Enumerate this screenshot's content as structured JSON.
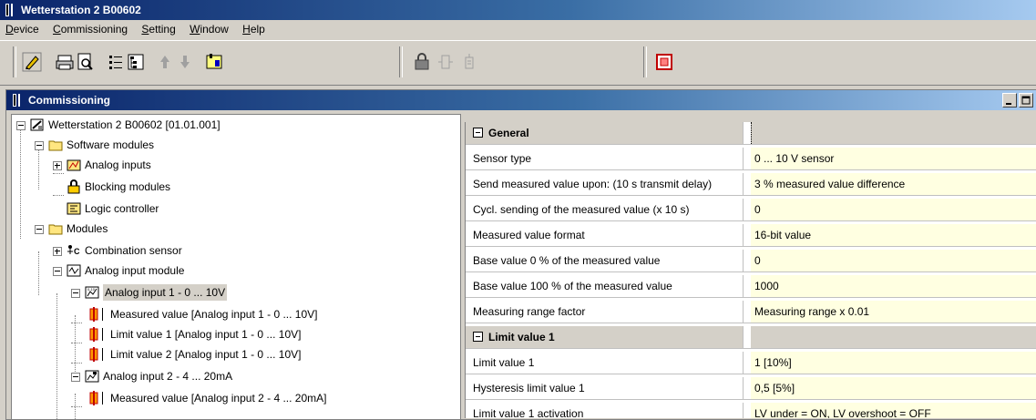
{
  "app": {
    "title": "Wetterstation 2 B00602"
  },
  "menu": [
    {
      "label": "Device",
      "u": "D",
      "rest": "evice"
    },
    {
      "label": "Commissioning",
      "u": "C",
      "rest": "ommissioning"
    },
    {
      "label": "Setting",
      "u": "S",
      "rest": "etting"
    },
    {
      "label": "Window",
      "u": "W",
      "rest": "indow"
    },
    {
      "label": "Help",
      "u": "H",
      "rest": "elp"
    }
  ],
  "child_window": {
    "title": "Commissioning"
  },
  "tree": {
    "root": "Wetterstation 2 B00602 [01.01.001]",
    "software_modules": "Software modules",
    "analog_inputs": "Analog inputs",
    "blocking_modules": "Blocking modules",
    "logic_controller": "Logic controller",
    "modules": "Modules",
    "combination_sensor": "Combination sensor",
    "analog_input_module": "Analog input module",
    "analog_input_1": "Analog input 1 - 0 ... 10V",
    "ai1_measured": "Measured value [Analog input 1 - 0 ... 10V]",
    "ai1_limit1": "Limit value 1 [Analog input 1 - 0 ... 10V]",
    "ai1_limit2": "Limit value 2 [Analog input 1 - 0 ... 10V]",
    "analog_input_2": "Analog input 2 - 4 ... 20mA",
    "ai2_measured": "Measured value [Analog input 2 - 4 ... 20mA]"
  },
  "properties": {
    "general_header": "General",
    "rows": [
      {
        "name": "Sensor type",
        "value": "0 ... 10 V sensor"
      },
      {
        "name": "Send measured value upon: (10 s transmit delay)",
        "value": "3 % measured value difference"
      },
      {
        "name": "Cycl. sending of the measured value (x 10 s)",
        "value": "0"
      },
      {
        "name": "Measured value format",
        "value": "16-bit value"
      },
      {
        "name": "Base value 0 % of the measured value",
        "value": "0"
      },
      {
        "name": "Base value 100 % of the measured value",
        "value": "1000"
      },
      {
        "name": "Measuring range factor",
        "value": "Measuring range x 0.01"
      }
    ],
    "limit_header": "Limit value 1",
    "limit_rows": [
      {
        "name": "Limit value 1",
        "value": "1 [10%]"
      },
      {
        "name": "Hysteresis limit value 1",
        "value": "0,5 [5%]"
      },
      {
        "name": "Limit value 1 activation",
        "value": "LV under = ON, LV overshoot = OFF"
      }
    ]
  },
  "colors": {
    "titlebar": "#0a246a",
    "value_bg": "#ffffe1",
    "face": "#d4d0c8"
  }
}
